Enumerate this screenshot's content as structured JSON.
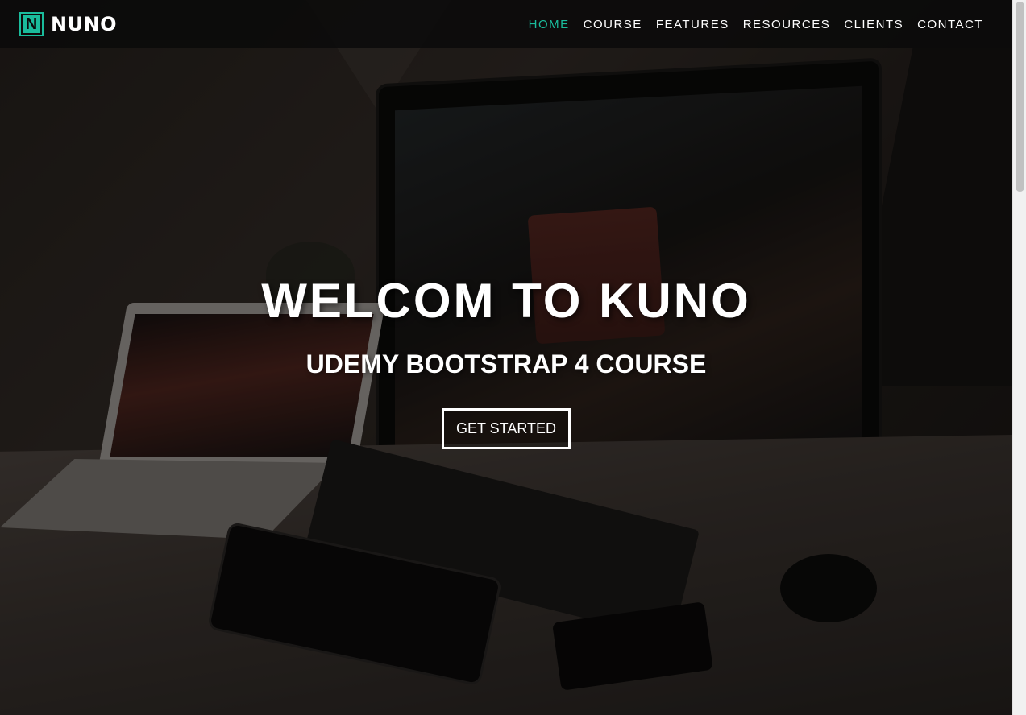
{
  "brand": {
    "icon_letter": "N",
    "name": "NUNO"
  },
  "nav": {
    "items": [
      {
        "label": "HOME",
        "active": true
      },
      {
        "label": "COURSE",
        "active": false
      },
      {
        "label": "FEATURES",
        "active": false
      },
      {
        "label": "RESOURCES",
        "active": false
      },
      {
        "label": "CLIENTS",
        "active": false
      },
      {
        "label": "CONTACT",
        "active": false
      }
    ]
  },
  "hero": {
    "title": "WELCOM TO KUNO",
    "subtitle": "UDEMY BOOTSTRAP 4 COURSE",
    "cta_label": "GET STARTED"
  },
  "colors": {
    "accent": "#1abc9c",
    "navbar_bg": "#0a0a0a",
    "text": "#ffffff"
  },
  "scroll": {
    "position": 0.0
  }
}
